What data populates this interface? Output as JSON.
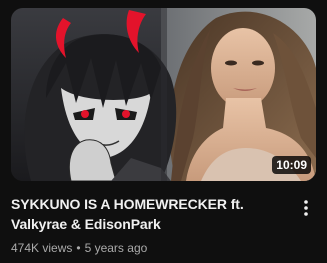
{
  "video": {
    "title": "SYKKUNO IS A HOMEWRECKER ft. Valkyrae & EdisonPark",
    "duration": "10:09",
    "views": "474K views",
    "age": "5 years ago",
    "separator": "•"
  },
  "icons": {
    "more": "more-vertical-icon"
  },
  "colors": {
    "background": "#0f0f0f",
    "title": "#f1f1f1",
    "secondary_text": "#aaaaaa",
    "duration_badge": "#000000cc",
    "devil_horns": "#e3132b"
  }
}
